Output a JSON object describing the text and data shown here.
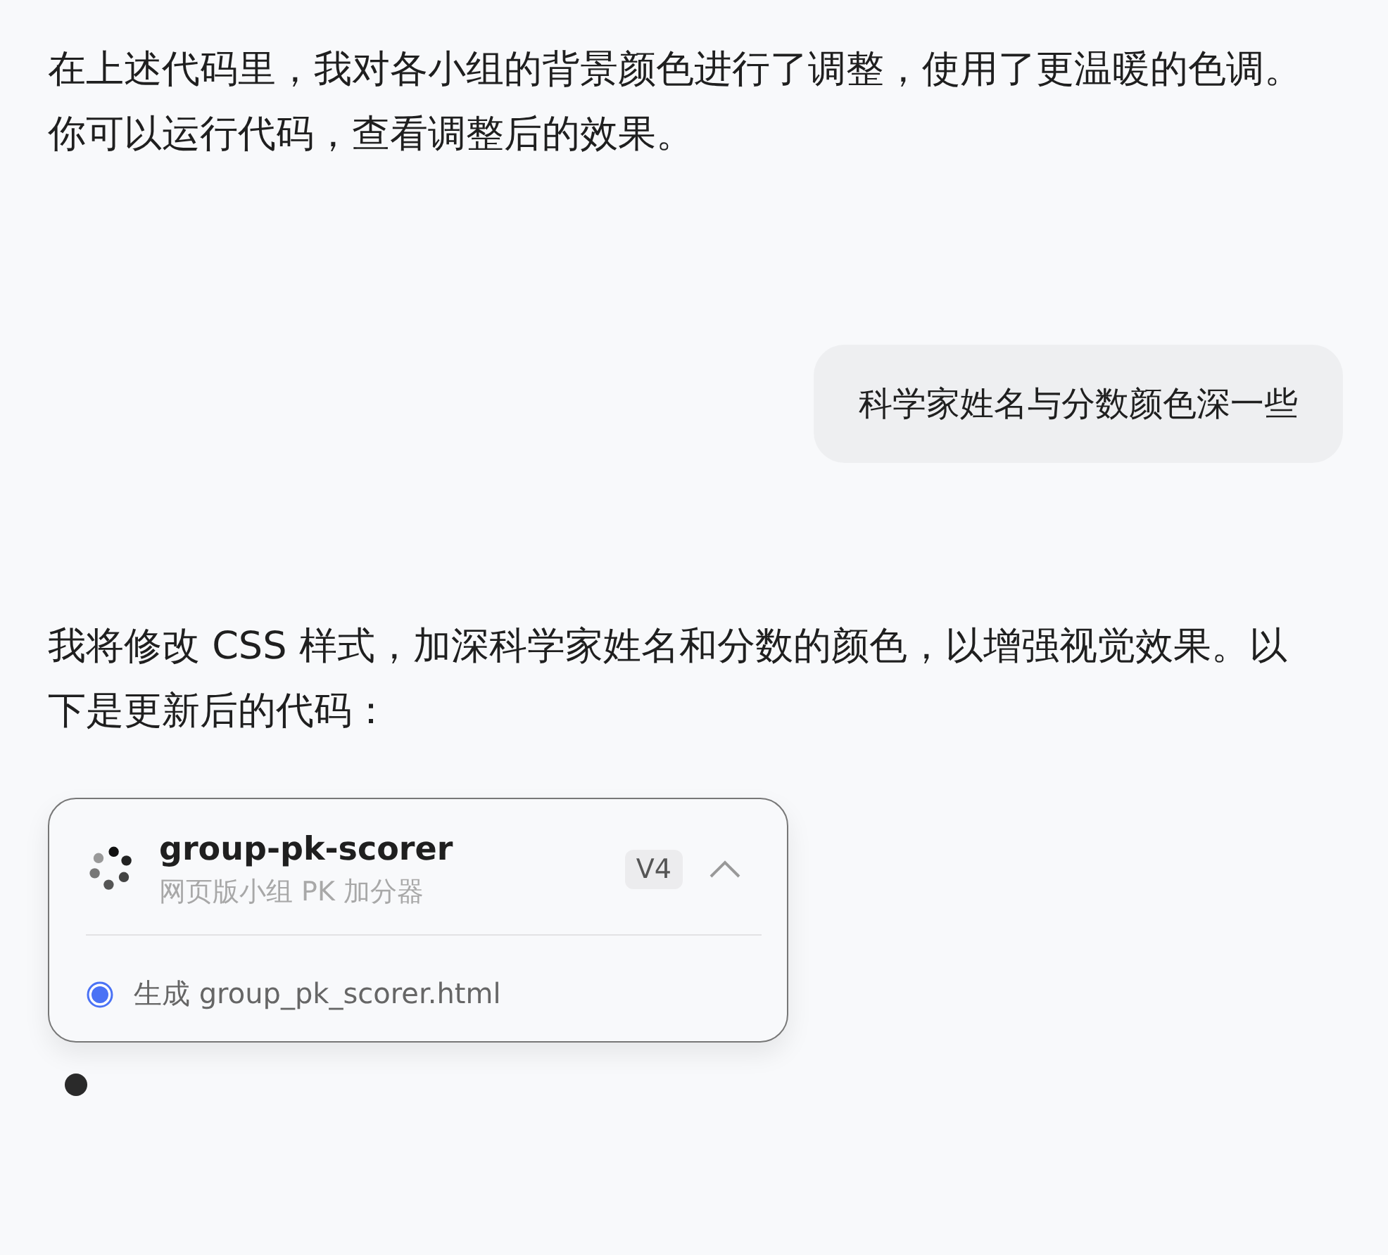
{
  "messages": [
    {
      "kind": "assistant",
      "text": "在上述代码里，我对各小组的背景颜色进行了调整，使用了更温暖的色调。你可以运行代码，查看调整后的效果。"
    },
    {
      "kind": "user",
      "text": "科学家姓名与分数颜色深一些"
    },
    {
      "kind": "assistant",
      "text": "我将修改 CSS 样式，加深科学家姓名和分数的颜色，以增强视觉效果。以下是更新后的代码："
    }
  ],
  "artifact": {
    "title": "group-pk-scorer",
    "subtitle": "网页版小组 PK 加分器",
    "version": "V4",
    "expanded": true,
    "steps": [
      {
        "label": "生成 group_pk_scorer.html",
        "kind": "running"
      }
    ]
  },
  "typing": true
}
